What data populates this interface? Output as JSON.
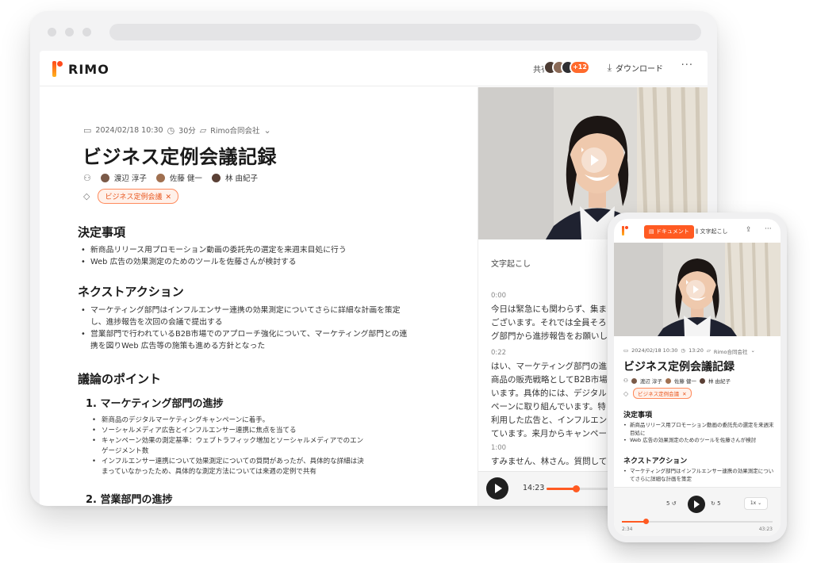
{
  "app": {
    "logo_text": "RIMO"
  },
  "header": {
    "share_label": "共有",
    "avatar_more": "+12",
    "download_label": "ダウンロード",
    "more_label": "···"
  },
  "doc": {
    "date": "2024/02/18 10:30",
    "duration": "30分",
    "folder": "Rimo合同会社",
    "title": "ビジネス定例会議記録",
    "participants": [
      "渡辺 淳子",
      "佐藤 健一",
      "林 由紀子"
    ],
    "tag": "ビジネス定例会議",
    "sections": {
      "decisions": {
        "title": "決定事項",
        "items": [
          "新商品リリース用プロモーション動画の委託先の選定を来週末目処に行う",
          "Web 広告の効果測定のためのツールを佐藤さんが検討する"
        ]
      },
      "next_actions": {
        "title": "ネクストアクション",
        "items": [
          "マーケティング部門はインフルエンサー連携の効果測定についてさらに詳細な計画を策定し、進捗報告を次回の会議で提出する",
          "営業部門で行われているB2B市場でのアプローチ強化について、マーケティング部門との連携を図りWeb 広告等の施策も進める方針となった"
        ]
      },
      "points": {
        "title": "議論のポイント",
        "sub1_title": "1. マーケティング部門の進捗",
        "sub1_items": [
          "新商品のデジタルマーケティングキャンペーンに着手。",
          "ソーシャルメディア広告とインフルエンサー連携に焦点を当てる",
          "キャンペーン効果の測定基準：ウェブトラフィック増加とソーシャルメディアでのエンゲージメント数",
          "インフルエンサー連携について効果測定についての質問があったが、具体的な詳細は決まっていなかったため、具体的な測定方法については来週の定例で共有"
        ],
        "sub2_title": "2. 営業部門の進捗"
      }
    }
  },
  "transcript": {
    "label": "文字起こし",
    "segments": [
      {
        "time": "0:00",
        "text": "今日は緊急にも関わらず、集まって\nございます。それでは全員そろい\nグ部門から進捗報告をお願いし"
      },
      {
        "time": "0:22",
        "text": "はい、マーケティング部門の進\n商品の販売戦略としてB2B市場\nいます。具体的には、デジタル\nペーンに取り組んでいます。特\n利用した広告と、インフルエン\nています。来月からキャンペー"
      },
      {
        "time": "1:00",
        "text": "すみません、林さん。質問して"
      }
    ]
  },
  "player": {
    "current_time": "14:23",
    "progress": 0.18
  },
  "mobile": {
    "tab_document": "ドキュメント",
    "tab_transcript": "文字起こし",
    "date": "2024/02/18 10:30",
    "duration": "13:20",
    "folder": "Rimo合同会社",
    "title": "ビジネス定例会議記録",
    "participants": [
      "渡辺 淳子",
      "佐藤 健一",
      "林 由紀子"
    ],
    "tag": "ビジネス定例会議",
    "decisions_title": "決定事項",
    "decisions_items": [
      "新商品リリース用プロモーション動画の委託先の選定を来週末目処に",
      "Web 広告の効果測定のためのツールを佐藤さんが検討"
    ],
    "next_title": "ネクストアクション",
    "next_items": [
      "マーケティング部門はインフルエンサー連携の効果測定についてさらに詳細な計画を策定"
    ],
    "skip_back": "5",
    "skip_forward": "5",
    "speed": "1x",
    "time_current": "2:34",
    "time_total": "43:23",
    "progress": 0.16
  },
  "colors": {
    "accent": "#ff5a22",
    "tag_border": "#ff8a5c",
    "tag_bg": "#fff1ea"
  }
}
